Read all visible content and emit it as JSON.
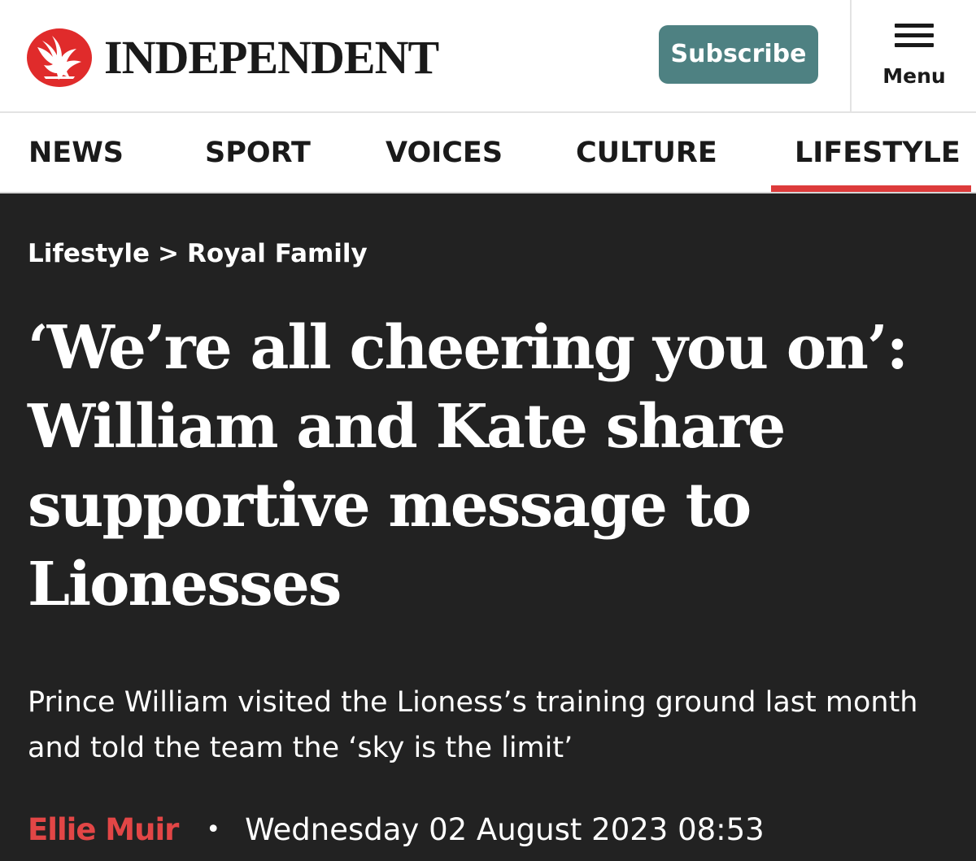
{
  "header": {
    "brand": "INDEPENDENT",
    "subscribe_label": "Subscribe",
    "menu_label": "Menu",
    "logo_icon": "eagle-icon"
  },
  "nav": {
    "items": [
      {
        "label": "NEWS"
      },
      {
        "label": "SPORT"
      },
      {
        "label": "VOICES"
      },
      {
        "label": "CULTURE"
      },
      {
        "label": "LIFESTYLE"
      }
    ],
    "active": "LIFESTYLE"
  },
  "breadcrumb": {
    "section": "Lifestyle",
    "separator": ">",
    "subsection": "Royal Family"
  },
  "article": {
    "headline": "‘We’re all cheering you on’: William and Kate share supportive message to Lionesses",
    "standfirst": "Prince William visited the Lioness’s training ground last month and told the team the ‘sky is the limit’",
    "author": "Ellie Muir",
    "separator": "•",
    "date": "Wednesday 02 August 2023 08:53"
  },
  "colors": {
    "brand_red": "#e02b2b",
    "subscribe_bg": "#4e8182",
    "active_underline": "#dd3b3b",
    "author": "#e24646",
    "hero_bg": "#222222"
  }
}
